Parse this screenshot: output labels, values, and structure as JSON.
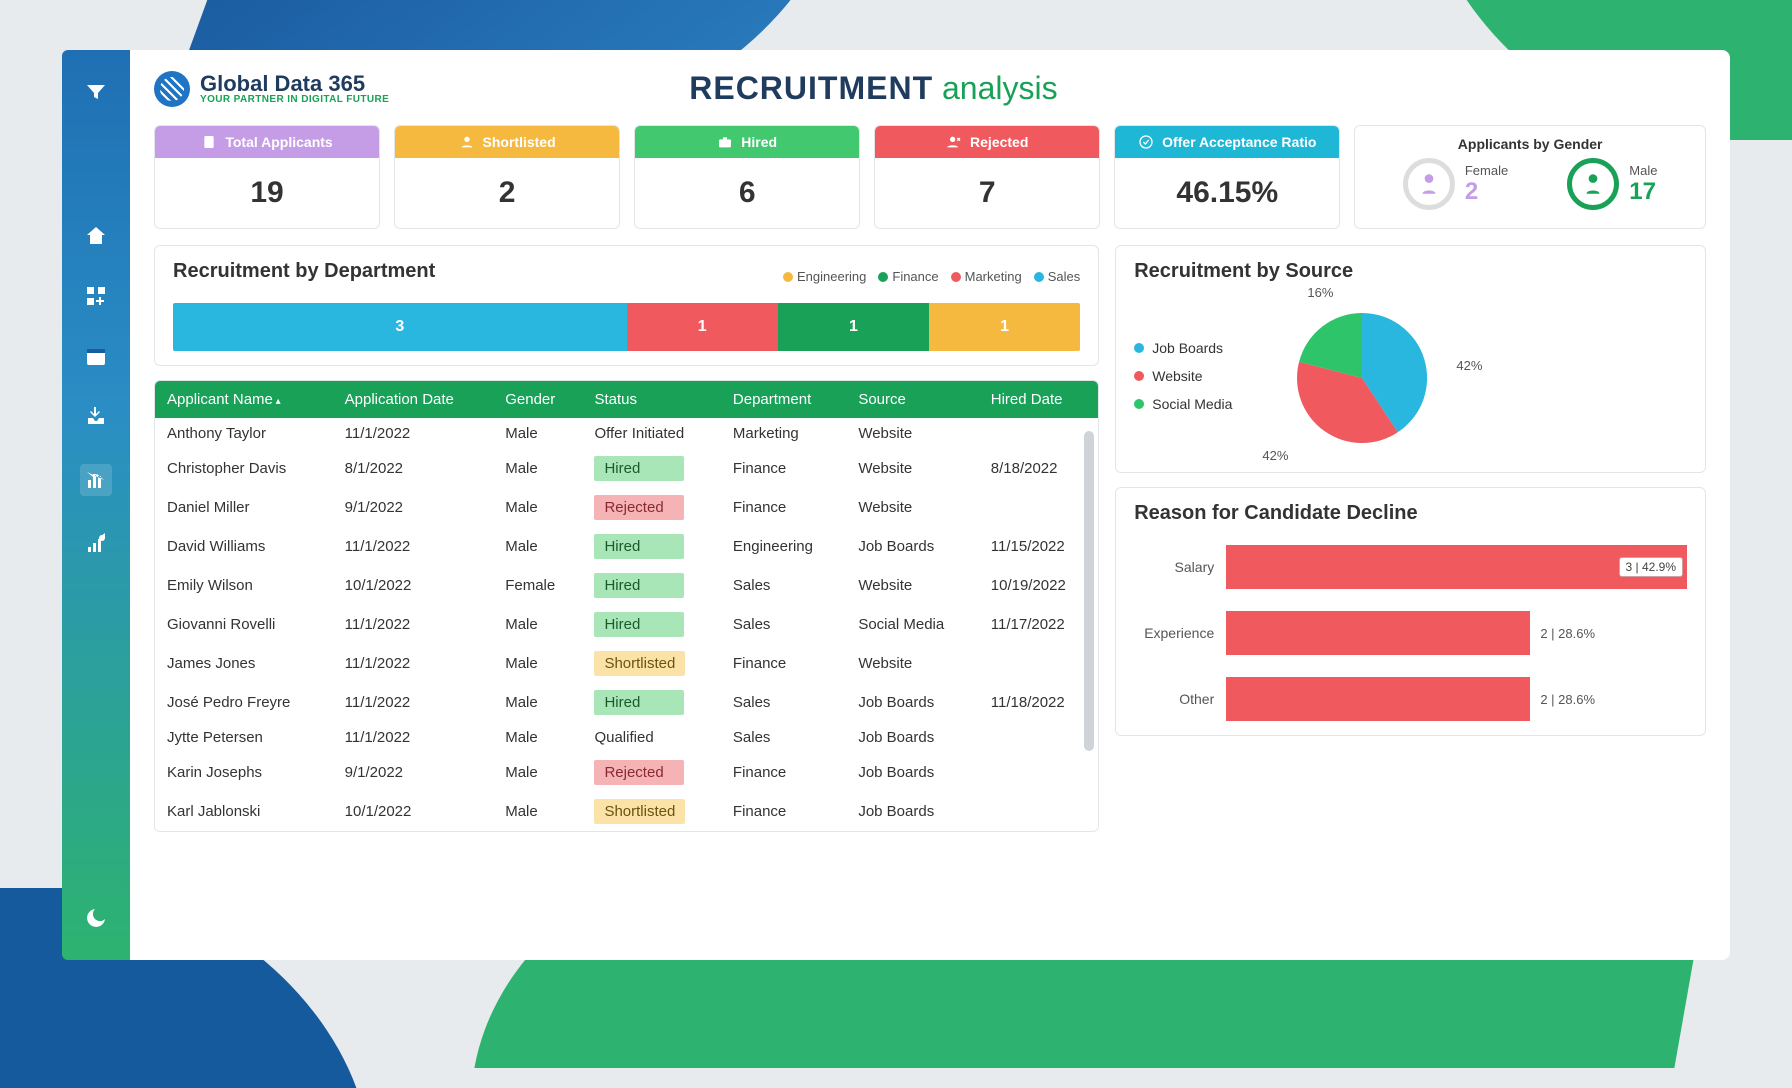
{
  "brand": {
    "name": "Global Data 365",
    "tagline": "YOUR PARTNER IN DIGITAL FUTURE"
  },
  "title": {
    "p1": "RECRUITMENT",
    "p2": "analysis"
  },
  "kpis": {
    "total": {
      "label": "Total Applicants",
      "value": "19"
    },
    "shortlisted": {
      "label": "Shortlisted",
      "value": "2"
    },
    "hired": {
      "label": "Hired",
      "value": "6"
    },
    "rejected": {
      "label": "Rejected",
      "value": "7"
    },
    "ratio": {
      "label": "Offer Acceptance Ratio",
      "value": "46.15%"
    }
  },
  "gender": {
    "title": "Applicants by Gender",
    "female": {
      "label": "Female",
      "value": "2"
    },
    "male": {
      "label": "Male",
      "value": "17"
    }
  },
  "dept": {
    "title": "Recruitment by Department",
    "legend": {
      "eng": "Engineering",
      "fin": "Finance",
      "mkt": "Marketing",
      "sal": "Sales"
    },
    "segs": {
      "sales": "3",
      "marketing": "1",
      "finance": "1",
      "engineering": "1"
    }
  },
  "table": {
    "cols": {
      "name": "Applicant Name",
      "date": "Application Date",
      "gender": "Gender",
      "status": "Status",
      "dept": "Department",
      "source": "Source",
      "hired": "Hired Date"
    },
    "rows": [
      {
        "name": "Anthony Taylor",
        "date": "11/1/2022",
        "gender": "Male",
        "status": "Offer Initiated",
        "scls": "",
        "dept": "Marketing",
        "source": "Website",
        "hired": ""
      },
      {
        "name": "Christopher Davis",
        "date": "8/1/2022",
        "gender": "Male",
        "status": "Hired",
        "scls": "st-hired",
        "dept": "Finance",
        "source": "Website",
        "hired": "8/18/2022"
      },
      {
        "name": "Daniel Miller",
        "date": "9/1/2022",
        "gender": "Male",
        "status": "Rejected",
        "scls": "st-rejected",
        "dept": "Finance",
        "source": "Website",
        "hired": ""
      },
      {
        "name": "David Williams",
        "date": "11/1/2022",
        "gender": "Male",
        "status": "Hired",
        "scls": "st-hired",
        "dept": "Engineering",
        "source": "Job Boards",
        "hired": "11/15/2022"
      },
      {
        "name": "Emily Wilson",
        "date": "10/1/2022",
        "gender": "Female",
        "status": "Hired",
        "scls": "st-hired",
        "dept": "Sales",
        "source": "Website",
        "hired": "10/19/2022"
      },
      {
        "name": "Giovanni Rovelli",
        "date": "11/1/2022",
        "gender": "Male",
        "status": "Hired",
        "scls": "st-hired",
        "dept": "Sales",
        "source": "Social Media",
        "hired": "11/17/2022"
      },
      {
        "name": "James Jones",
        "date": "11/1/2022",
        "gender": "Male",
        "status": "Shortlisted",
        "scls": "st-shortlisted",
        "dept": "Finance",
        "source": "Website",
        "hired": ""
      },
      {
        "name": "José Pedro Freyre",
        "date": "11/1/2022",
        "gender": "Male",
        "status": "Hired",
        "scls": "st-hired",
        "dept": "Sales",
        "source": "Job Boards",
        "hired": "11/18/2022"
      },
      {
        "name": "Jytte Petersen",
        "date": "11/1/2022",
        "gender": "Male",
        "status": "Qualified",
        "scls": "",
        "dept": "Sales",
        "source": "Job Boards",
        "hired": ""
      },
      {
        "name": "Karin Josephs",
        "date": "9/1/2022",
        "gender": "Male",
        "status": "Rejected",
        "scls": "st-rejected",
        "dept": "Finance",
        "source": "Job Boards",
        "hired": ""
      },
      {
        "name": "Karl Jablonski",
        "date": "10/1/2022",
        "gender": "Male",
        "status": "Shortlisted",
        "scls": "st-shortlisted",
        "dept": "Finance",
        "source": "Job Boards",
        "hired": ""
      }
    ]
  },
  "source": {
    "title": "Recruitment by Source",
    "legend": {
      "jb": "Job Boards",
      "web": "Website",
      "sm": "Social Media"
    },
    "labels": {
      "jb": "42%",
      "web": "42%",
      "sm": "16%"
    }
  },
  "decline": {
    "title": "Reason for Candidate Decline",
    "rows": {
      "salary": {
        "label": "Salary",
        "tooltip": "3 | 42.9%"
      },
      "exp": {
        "label": "Experience",
        "val": "2 | 28.6%"
      },
      "other": {
        "label": "Other",
        "val": "2 | 28.6%"
      }
    }
  },
  "chart_data": [
    {
      "type": "bar",
      "title": "Recruitment by Department",
      "orientation": "horizontal-stacked",
      "categories": [
        "Sales",
        "Marketing",
        "Finance",
        "Engineering"
      ],
      "values": [
        3,
        1,
        1,
        1
      ],
      "colors": [
        "#29b7e0",
        "#f05a5f",
        "#18a157",
        "#f5b93f"
      ]
    },
    {
      "type": "pie",
      "title": "Recruitment by Source",
      "series": [
        {
          "name": "Job Boards",
          "value": 42,
          "color": "#29b7e0"
        },
        {
          "name": "Website",
          "value": 42,
          "color": "#f05a5f"
        },
        {
          "name": "Social Media",
          "value": 16,
          "color": "#2ec46a"
        }
      ]
    },
    {
      "type": "bar",
      "title": "Reason for Candidate Decline",
      "orientation": "horizontal",
      "categories": [
        "Salary",
        "Experience",
        "Other"
      ],
      "values": [
        3,
        2,
        2
      ],
      "percent": [
        42.9,
        28.6,
        28.6
      ],
      "color": "#f05a5f"
    },
    {
      "type": "table",
      "title": "Applicants",
      "columns": [
        "Applicant Name",
        "Application Date",
        "Gender",
        "Status",
        "Department",
        "Source",
        "Hired Date"
      ]
    }
  ]
}
